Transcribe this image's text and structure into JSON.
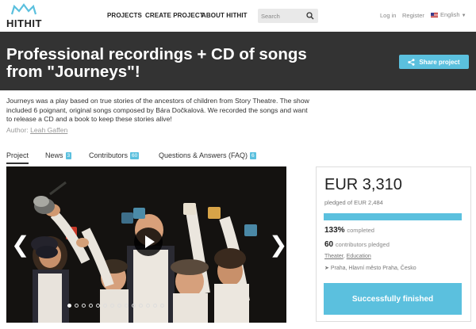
{
  "nav": {
    "logo_text": "HITHIT",
    "links": [
      "PROJECTS",
      "CREATE PROJECT",
      "ABOUT HITHIT"
    ],
    "search_placeholder": "Search",
    "login": "Log in",
    "register": "Register",
    "language": "English"
  },
  "banner": {
    "title": "Professional recordings + CD of songs from \"Journeys\"!",
    "share_label": "Share project"
  },
  "description": {
    "text": "Journeys was a play based on true stories of the ancestors of children from Story Theatre. The show included 6 poignant, original songs composed by Bára Dočkalová. We recorded the songs and want to release a CD and a book to keep these stories alive!",
    "author_label": "Author:",
    "author_name": "Leah Gaffen"
  },
  "tabs": [
    {
      "label": "Project",
      "count": ""
    },
    {
      "label": "News",
      "count": "3"
    },
    {
      "label": "Contributors",
      "count": "60"
    },
    {
      "label": "Questions & Answers (FAQ)",
      "count": "6"
    }
  ],
  "media": {
    "prev_arrow": "❮",
    "next_arrow": "❯",
    "slide_count": 14,
    "active_slide": 0
  },
  "funding": {
    "amount": "EUR 3,310",
    "pledged_of": "pledged of EUR 2,484",
    "progress_fraction": 1.0,
    "percent": "133%",
    "percent_label": "completed",
    "contributors": "60",
    "contributors_label": "contributors pledged",
    "category_1": "Theater",
    "category_2": "Education",
    "location": "Praha, Hlavní město Praha, Česko",
    "status": "Successfully finished"
  },
  "colors": {
    "accent": "#5bc0de",
    "banner": "#333333"
  }
}
